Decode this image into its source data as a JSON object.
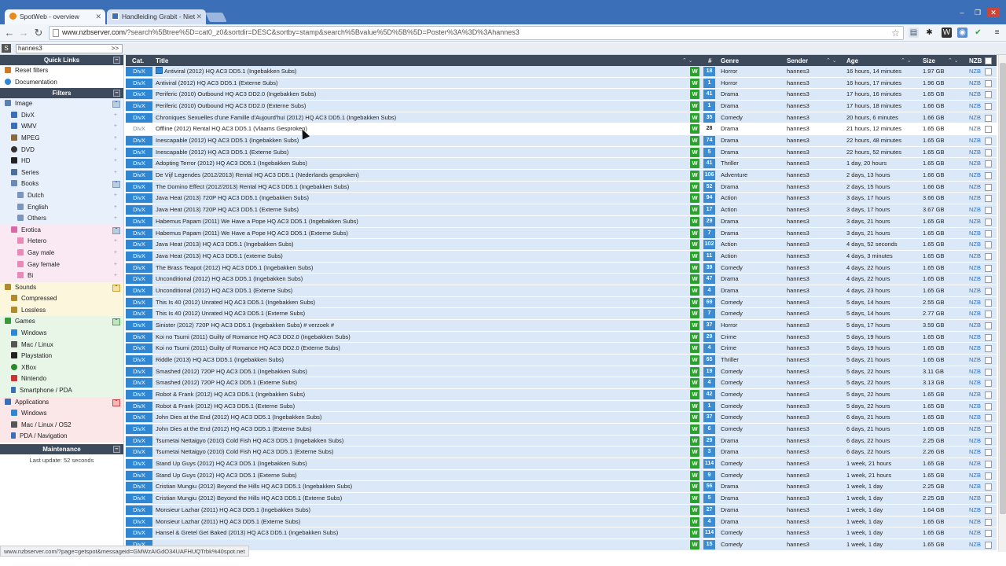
{
  "browser": {
    "tabs": [
      {
        "title": "SpotWeb - overview"
      },
      {
        "title": "Handleiding Grabit - Niet"
      }
    ],
    "url_host": "www.nzbserver.com",
    "url_rest": "/?search%5Btree%5D=cat0_z0&sortdir=DESC&sortby=stamp&search%5Bvalue%5D%5B%5D=Poster%3A%3D%3Ahannes3",
    "status_url": "www.nzbserver.com/?page=getspot&messageid=GMWzAIGdO34UAFHUQTrbk%40spot.net"
  },
  "search": {
    "value": "hannes3",
    "go": ">>"
  },
  "sidebar": {
    "quick_links": "Quick Links",
    "reset": "Reset filters",
    "documentation": "Documentation",
    "filters": "Filters",
    "image": "Image",
    "divx": "DivX",
    "wmv": "WMV",
    "mpeg": "MPEG",
    "dvd": "DVD",
    "hd": "HD",
    "series": "Series",
    "books": "Books",
    "dutch": "Dutch",
    "english": "English",
    "others": "Others",
    "erotica": "Erotica",
    "hetero": "Hetero",
    "gay_male": "Gay male",
    "gay_female": "Gay female",
    "bi": "Bi",
    "sounds": "Sounds",
    "compressed": "Compressed",
    "lossless": "Lossless",
    "games": "Games",
    "g_windows": "Windows",
    "g_mac": "Mac / Linux",
    "playstation": "Playstation",
    "xbox": "XBox",
    "nintendo": "Nintendo",
    "smartphone": "Smartphone / PDA",
    "applications": "Applications",
    "a_windows": "Windows",
    "a_mac": "Mac / Linux / OS2",
    "pda": "PDA / Navigation",
    "maintenance": "Maintenance",
    "last_update": "Last update: 52 seconds"
  },
  "table": {
    "headers": {
      "cat": "Cat.",
      "title": "Title",
      "num": "#",
      "genre": "Genre",
      "sender": "Sender",
      "age": "Age",
      "size": "Size",
      "nzb": "NZB"
    },
    "rows": [
      {
        "cat": "DivX",
        "title": "Antiviral (2012) HQ AC3 DD5.1 (Ingebakken Subs)",
        "count": "18",
        "genre": "Horror",
        "sender": "hannes3",
        "age": "16 hours, 14 minutes",
        "size": "1.97 GB"
      },
      {
        "cat": "DivX",
        "title": "Antiviral (2012) HQ AC3 DD5.1 (Externe Subs)",
        "count": "1",
        "genre": "Horror",
        "sender": "hannes3",
        "age": "16 hours, 17 minutes",
        "size": "1.96 GB"
      },
      {
        "cat": "DivX",
        "title": "Periferic (2010) Outbound HQ AC3 DD2.0 (Ingebakken Subs)",
        "count": "41",
        "genre": "Drama",
        "sender": "hannes3",
        "age": "17 hours, 16 minutes",
        "size": "1.65 GB"
      },
      {
        "cat": "DivX",
        "title": "Periferic (2010) Outbound HQ AC3 DD2.0 (Externe Subs)",
        "count": "1",
        "genre": "Drama",
        "sender": "hannes3",
        "age": "17 hours, 18 minutes",
        "size": "1.66 GB"
      },
      {
        "cat": "DivX",
        "title": "Chroniques Sexuelles d'une Famille d'Aujourd'hui (2012) HQ AC3 DD5.1 (Ingebakken Subs)",
        "count": "35",
        "genre": "Comedy",
        "sender": "hannes3",
        "age": "20 hours, 6 minutes",
        "size": "1.66 GB"
      },
      {
        "cat": "DivX",
        "title": "Offline (2012) Rental HQ AC3 DD5.1 (Vlaams Gesproken)",
        "count": "28",
        "genre": "Drama",
        "sender": "hannes3",
        "age": "21 hours, 12 minutes",
        "size": "1.65 GB"
      },
      {
        "cat": "DivX",
        "title": "Inescapable (2012) HQ AC3 DD5.1 (Ingebakken Subs)",
        "count": "74",
        "genre": "Drama",
        "sender": "hannes3",
        "age": "22 hours, 48 minutes",
        "size": "1.65 GB"
      },
      {
        "cat": "DivX",
        "title": "Inescapable (2012) HQ AC3 DD5.1 (Externe Subs)",
        "count": "5",
        "genre": "Drama",
        "sender": "hannes3",
        "age": "22 hours, 52 minutes",
        "size": "1.65 GB"
      },
      {
        "cat": "DivX",
        "title": "Adopting Terror (2012) HQ AC3 DD5.1 (Ingebakken Subs)",
        "count": "41",
        "genre": "Thriller",
        "sender": "hannes3",
        "age": "1 day, 20 hours",
        "size": "1.65 GB"
      },
      {
        "cat": "DivX",
        "title": "De Vijf Legendes (2012/2013) Rental HQ AC3 DD5.1 (Nederlands gesproken)",
        "count": "106",
        "genre": "Adventure",
        "sender": "hannes3",
        "age": "2 days, 13 hours",
        "size": "1.66 GB"
      },
      {
        "cat": "DivX",
        "title": "The Domino Effect (2012/2013) Rental HQ AC3 DD5.1 (Ingebakken Subs)",
        "count": "52",
        "genre": "Drama",
        "sender": "hannes3",
        "age": "2 days, 15 hours",
        "size": "1.66 GB"
      },
      {
        "cat": "DivX",
        "title": "Java Heat (2013) 720P HQ AC3 DD5.1 (Ingebakken Subs)",
        "count": "94",
        "genre": "Action",
        "sender": "hannes3",
        "age": "3 days, 17 hours",
        "size": "3.66 GB"
      },
      {
        "cat": "DivX",
        "title": "Java Heat (2013) 720P HQ AC3 DD5.1 (Externe Subs)",
        "count": "17",
        "genre": "Action",
        "sender": "hannes3",
        "age": "3 days, 17 hours",
        "size": "3.67 GB"
      },
      {
        "cat": "DivX",
        "title": "Habemus Papam (2011) We Have a Pope HQ AC3 DD5.1 (Ingebakken Subs)",
        "count": "29",
        "genre": "Drama",
        "sender": "hannes3",
        "age": "3 days, 21 hours",
        "size": "1.65 GB"
      },
      {
        "cat": "DivX",
        "title": "Habemus Papam (2011) We Have a Pope HQ AC3 DD5.1 (Externe Subs)",
        "count": "7",
        "genre": "Drama",
        "sender": "hannes3",
        "age": "3 days, 21 hours",
        "size": "1.65 GB"
      },
      {
        "cat": "DivX",
        "title": "Java Heat (2013) HQ AC3 DD5.1 (Ingebakken Subs)",
        "count": "102",
        "genre": "Action",
        "sender": "hannes3",
        "age": "4 days, 52 seconds",
        "size": "1.65 GB"
      },
      {
        "cat": "DivX",
        "title": "Java Heat (2013) HQ AC3 DD5.1 (externe Subs)",
        "count": "11",
        "genre": "Action",
        "sender": "hannes3",
        "age": "4 days, 3 minutes",
        "size": "1.65 GB"
      },
      {
        "cat": "DivX",
        "title": "The Brass Teapot (2012) HQ AC3 DD5.1 (Ingebakken Subs)",
        "count": "39",
        "genre": "Comedy",
        "sender": "hannes3",
        "age": "4 days, 22 hours",
        "size": "1.65 GB"
      },
      {
        "cat": "DivX",
        "title": "Unconditional (2012) HQ AC3 DD5.1 (Ingebakken Subs)",
        "count": "47",
        "genre": "Drama",
        "sender": "hannes3",
        "age": "4 days, 22 hours",
        "size": "1.65 GB"
      },
      {
        "cat": "DivX",
        "title": "Unconditional (2012) HQ AC3 DD5.1 (Externe Subs)",
        "count": "4",
        "genre": "Drama",
        "sender": "hannes3",
        "age": "4 days, 23 hours",
        "size": "1.65 GB"
      },
      {
        "cat": "DivX",
        "title": "This Is 40 (2012) Unrated HQ AC3 DD5.1 (Ingebakken Subs)",
        "count": "69",
        "genre": "Comedy",
        "sender": "hannes3",
        "age": "5 days, 14 hours",
        "size": "2.55 GB"
      },
      {
        "cat": "DivX",
        "title": "This Is 40 (2012) Unrated HQ AC3 DD5.1 (Externe Subs)",
        "count": "7",
        "genre": "Comedy",
        "sender": "hannes3",
        "age": "5 days, 14 hours",
        "size": "2.77 GB"
      },
      {
        "cat": "DivX",
        "title": "Sinister (2012) 720P HQ AC3 DD5.1 (Ingebakken Subs) # verzoek #",
        "count": "37",
        "genre": "Horror",
        "sender": "hannes3",
        "age": "5 days, 17 hours",
        "size": "3.59 GB"
      },
      {
        "cat": "DivX",
        "title": "Koi no Tsumi (2011) Guilty of Romance HQ AC3 DD2.0 (Ingebakken Subs)",
        "count": "29",
        "genre": "Crime",
        "sender": "hannes3",
        "age": "5 days, 19 hours",
        "size": "1.65 GB"
      },
      {
        "cat": "DivX",
        "title": "Koi no Tsumi (2011) Guilty of Romance HQ AC3 DD2.0 (Externe Subs)",
        "count": "4",
        "genre": "Crime",
        "sender": "hannes3",
        "age": "5 days, 19 hours",
        "size": "1.65 GB"
      },
      {
        "cat": "DivX",
        "title": "Riddle (2013) HQ AC3 DD5.1 (Ingebakken Subs)",
        "count": "65",
        "genre": "Thriller",
        "sender": "hannes3",
        "age": "5 days, 21 hours",
        "size": "1.65 GB"
      },
      {
        "cat": "DivX",
        "title": "Smashed (2012) 720P HQ AC3 DD5.1 (Ingebakken Subs)",
        "count": "19",
        "genre": "Comedy",
        "sender": "hannes3",
        "age": "5 days, 22 hours",
        "size": "3.11 GB"
      },
      {
        "cat": "DivX",
        "title": "Smashed (2012) 720P HQ AC3 DD5.1 (Externe Subs)",
        "count": "4",
        "genre": "Comedy",
        "sender": "hannes3",
        "age": "5 days, 22 hours",
        "size": "3.13 GB"
      },
      {
        "cat": "DivX",
        "title": "Robot & Frank (2012) HQ AC3 DD5.1 (Ingebakken Subs)",
        "count": "42",
        "genre": "Comedy",
        "sender": "hannes3",
        "age": "5 days, 22 hours",
        "size": "1.65 GB"
      },
      {
        "cat": "DivX",
        "title": "Robot & Frank (2012) HQ AC3 DD5.1 (Externe Subs)",
        "count": "1",
        "genre": "Comedy",
        "sender": "hannes3",
        "age": "5 days, 22 hours",
        "size": "1.65 GB"
      },
      {
        "cat": "DivX",
        "title": "John Dies at the End (2012) HQ AC3 DD5.1 (Ingebakken Subs)",
        "count": "37",
        "genre": "Comedy",
        "sender": "hannes3",
        "age": "6 days, 21 hours",
        "size": "1.65 GB"
      },
      {
        "cat": "DivX",
        "title": "John Dies at the End (2012) HQ AC3 DD5.1 (Externe Subs)",
        "count": "6",
        "genre": "Comedy",
        "sender": "hannes3",
        "age": "6 days, 21 hours",
        "size": "1.65 GB"
      },
      {
        "cat": "DivX",
        "title": "Tsumetai Nettaigyo (2010) Cold Fish HQ AC3 DD5.1 (Ingebakken Subs)",
        "count": "29",
        "genre": "Drama",
        "sender": "hannes3",
        "age": "6 days, 22 hours",
        "size": "2.25 GB"
      },
      {
        "cat": "DivX",
        "title": "Tsumetai Nettaigyo (2010) Cold Fish HQ AC3 DD5.1 (Externe Subs)",
        "count": "3",
        "genre": "Drama",
        "sender": "hannes3",
        "age": "6 days, 22 hours",
        "size": "2.26 GB"
      },
      {
        "cat": "DivX",
        "title": "Stand Up Guys (2012) HQ AC3 DD5.1 (Ingebakken Subs)",
        "count": "114",
        "genre": "Comedy",
        "sender": "hannes3",
        "age": "1 week, 21 hours",
        "size": "1.65 GB"
      },
      {
        "cat": "DivX",
        "title": "Stand Up Guys (2012) HQ AC3 DD5.1 (Externe Subs)",
        "count": "9",
        "genre": "Comedy",
        "sender": "hannes3",
        "age": "1 week, 21 hours",
        "size": "1.65 GB"
      },
      {
        "cat": "DivX",
        "title": "Cristian Mungiu (2012) Beyond the Hills HQ AC3 DD5.1 (Ingebakken Subs)",
        "count": "56",
        "genre": "Drama",
        "sender": "hannes3",
        "age": "1 week, 1 day",
        "size": "2.25 GB"
      },
      {
        "cat": "DivX",
        "title": "Cristian Mungiu (2012) Beyond the Hills HQ AC3 DD5.1 (Externe Subs)",
        "count": "5",
        "genre": "Drama",
        "sender": "hannes3",
        "age": "1 week, 1 day",
        "size": "2.25 GB"
      },
      {
        "cat": "DivX",
        "title": "Monsieur Lazhar (2011) HQ AC3 DD5.1 (Ingebakken Subs)",
        "count": "27",
        "genre": "Drama",
        "sender": "hannes3",
        "age": "1 week, 1 day",
        "size": "1.64 GB"
      },
      {
        "cat": "DivX",
        "title": "Monsieur Lazhar (2011) HQ AC3 DD5.1 (Externe Subs)",
        "count": "4",
        "genre": "Drama",
        "sender": "hannes3",
        "age": "1 week, 1 day",
        "size": "1.65 GB"
      },
      {
        "cat": "DivX",
        "title": "Hansel & Gretel Get Baked (2013) HQ AC3 DD5.1 (Ingebakken Subs)",
        "count": "114",
        "genre": "Comedy",
        "sender": "hannes3",
        "age": "1 week, 1 day",
        "size": "1.65 GB"
      },
      {
        "cat": "DivX",
        "title": "",
        "count": "15",
        "genre": "Comedy",
        "sender": "hannes3",
        "age": "1 week, 1 day",
        "size": "1.65 GB"
      }
    ],
    "nzb_label": "NZB",
    "highlight_row": 5
  },
  "colors": {
    "accent": "#2f86d3",
    "header": "#3c4a5c",
    "row": "#dbe8f7"
  }
}
